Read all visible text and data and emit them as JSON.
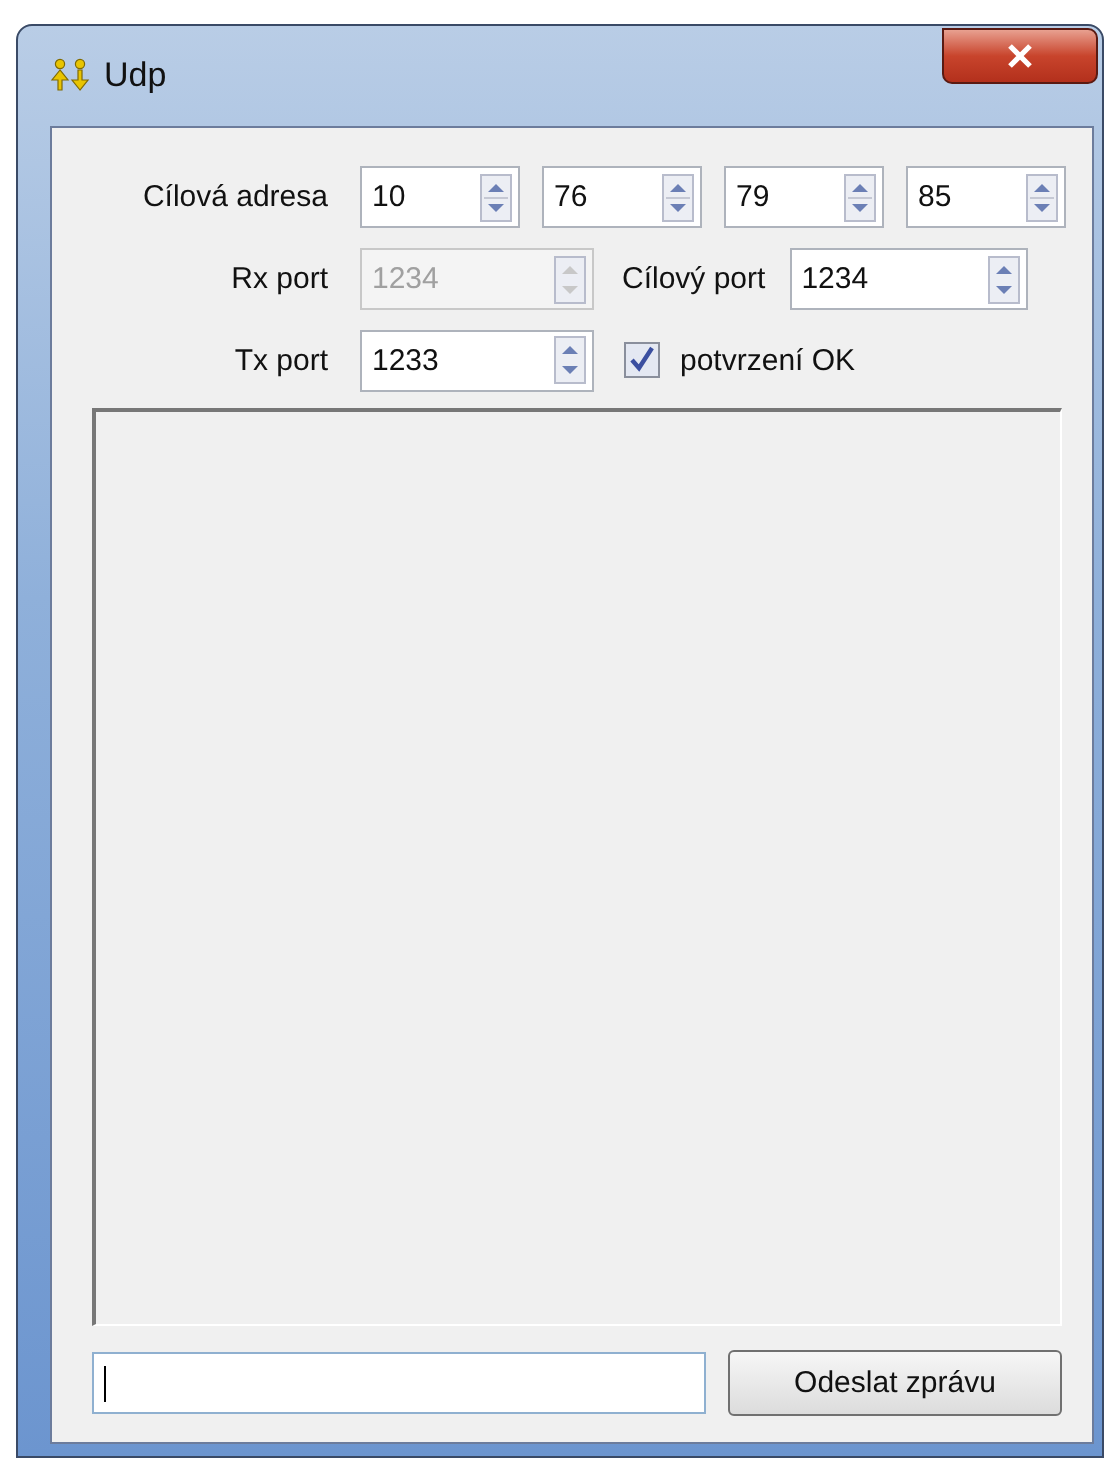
{
  "window": {
    "title": "Udp"
  },
  "address": {
    "label": "Cílová adresa",
    "octets": [
      {
        "value": "10",
        "disabled": false
      },
      {
        "value": "76",
        "disabled": false
      },
      {
        "value": "79",
        "disabled": false
      },
      {
        "value": "85",
        "disabled": false
      }
    ]
  },
  "rx_port": {
    "label": "Rx port",
    "value": "1234",
    "disabled": true
  },
  "target_port": {
    "label": "Cílový port",
    "value": "1234",
    "disabled": false
  },
  "tx_port": {
    "label": "Tx port",
    "value": "1233",
    "disabled": false
  },
  "confirm": {
    "label": "potvrzení OK",
    "checked": true
  },
  "send_button": {
    "label": "Odeslat zprávu"
  }
}
